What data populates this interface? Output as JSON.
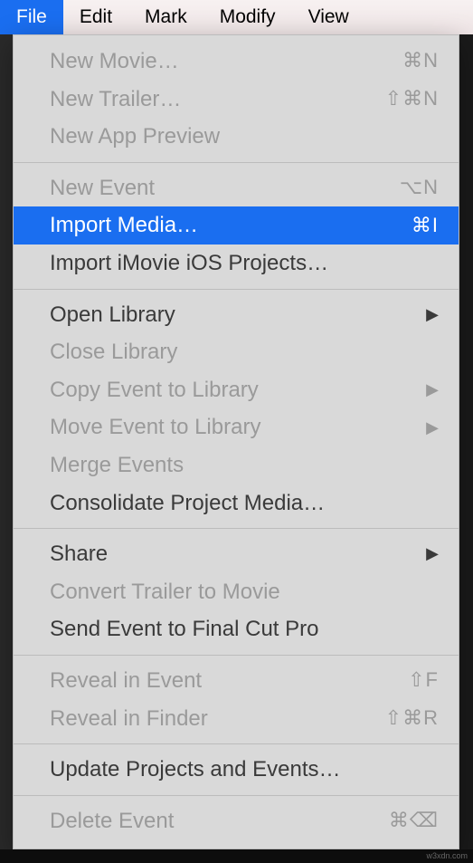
{
  "menubar": {
    "items": [
      {
        "label": "File",
        "active": true
      },
      {
        "label": "Edit",
        "active": false
      },
      {
        "label": "Mark",
        "active": false
      },
      {
        "label": "Modify",
        "active": false
      },
      {
        "label": "View",
        "active": false
      }
    ]
  },
  "menu": {
    "groups": [
      [
        {
          "label": "New Movie…",
          "shortcut": "⌘N",
          "disabled": true
        },
        {
          "label": "New Trailer…",
          "shortcut": "⇧⌘N",
          "disabled": true
        },
        {
          "label": "New App Preview",
          "shortcut": "",
          "disabled": true
        }
      ],
      [
        {
          "label": "New Event",
          "shortcut": "⌥N",
          "disabled": true
        },
        {
          "label": "Import Media…",
          "shortcut": "⌘I",
          "disabled": false,
          "selected": true
        },
        {
          "label": "Import iMovie iOS Projects…",
          "shortcut": "",
          "disabled": false
        }
      ],
      [
        {
          "label": "Open Library",
          "submenu": true,
          "disabled": false
        },
        {
          "label": "Close Library",
          "disabled": true
        },
        {
          "label": "Copy Event to Library",
          "submenu": true,
          "disabled": true
        },
        {
          "label": "Move Event to Library",
          "submenu": true,
          "disabled": true
        },
        {
          "label": "Merge Events",
          "disabled": true
        },
        {
          "label": "Consolidate Project Media…",
          "disabled": false
        }
      ],
      [
        {
          "label": "Share",
          "submenu": true,
          "disabled": false
        },
        {
          "label": "Convert Trailer to Movie",
          "disabled": true
        },
        {
          "label": "Send Event to Final Cut Pro",
          "disabled": false
        }
      ],
      [
        {
          "label": "Reveal in Event",
          "shortcut": "⇧F",
          "disabled": true
        },
        {
          "label": "Reveal in Finder",
          "shortcut": "⇧⌘R",
          "disabled": true
        }
      ],
      [
        {
          "label": "Update Projects and Events…",
          "disabled": false
        }
      ],
      [
        {
          "label": "Delete Event",
          "shortcut": "⌘⌫",
          "disabled": true
        }
      ]
    ]
  },
  "footer": {
    "watermark": "w3xdn.com"
  }
}
